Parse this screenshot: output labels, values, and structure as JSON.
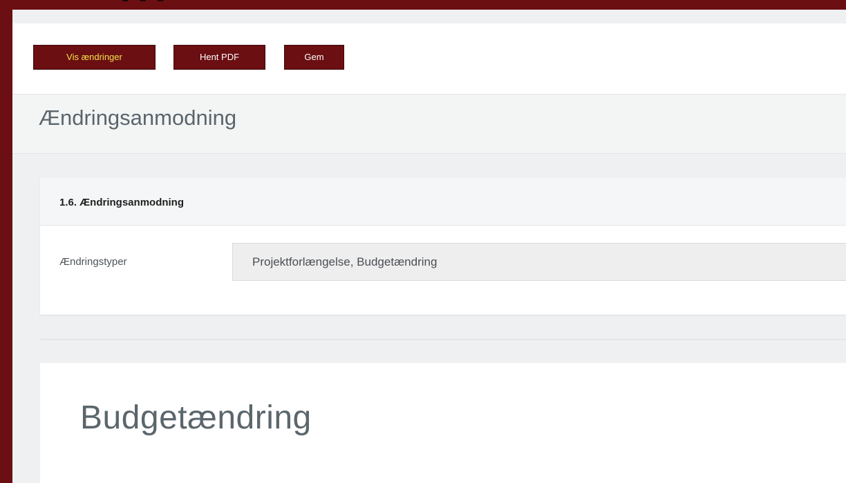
{
  "toolbar": {
    "show_changes_label": "Vis ændringer",
    "download_pdf_label": "Hent PDF",
    "save_label": "Gem"
  },
  "page": {
    "title": "Ændringsanmodning"
  },
  "change_request_section": {
    "header": "1.6. Ændringsanmodning",
    "change_types_label": "Ændringstyper",
    "change_types_value": "Projektforlængelse, Budgetændring"
  },
  "budget_section": {
    "title": "Budgetændring"
  },
  "colors": {
    "brand": "#6b0f12",
    "active_button_text": "#f2e24a",
    "page_background": "#eef0f1"
  }
}
